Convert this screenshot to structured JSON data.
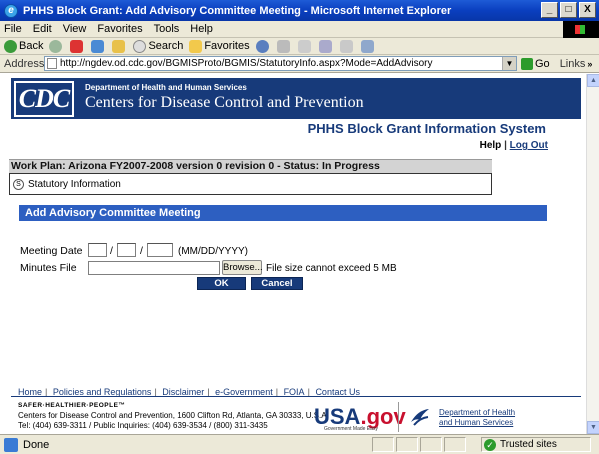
{
  "window": {
    "title": "PHHS Block Grant: Add Advisory Committee Meeting - Microsoft Internet Explorer",
    "minimize": "_",
    "maximize": "□",
    "close": "X"
  },
  "menu": [
    "File",
    "Edit",
    "View",
    "Favorites",
    "Tools",
    "Help"
  ],
  "toolbar": {
    "back": "Back",
    "search": "Search",
    "favorites": "Favorites"
  },
  "address": {
    "label": "Address",
    "url": "http://ngdev.od.cdc.gov/BGMISProto/BGMIS/StatutoryInfo.aspx?Mode=AddAdvisory",
    "go": "Go",
    "links": "Links"
  },
  "header": {
    "logo": "CDC",
    "department": "Department of Health and Human Services",
    "org_name": "Centers for Disease Control and Prevention",
    "system_title": "PHHS Block Grant Information System",
    "help": "Help",
    "separator": "|",
    "logout": "Log Out"
  },
  "workplan": {
    "title": "Work Plan: Arizona FY2007-2008 version 0 revision 0 - Status: In Progress",
    "step_icon": "S",
    "step_label": "Statutory Information"
  },
  "form": {
    "section_title": "Add Advisory Committee Meeting",
    "meeting_date_label": "Meeting Date",
    "date_sep": "/",
    "date_hint": "(MM/DD/YYYY)",
    "minutes_file_label": "Minutes File",
    "browse_label": "Browse...",
    "file_hint": "File size cannot exceed 5 MB",
    "ok_label": "OK",
    "cancel_label": "Cancel"
  },
  "footer": {
    "links": [
      "Home",
      "Policies and Regulations",
      "Disclaimer",
      "e-Government",
      "FOIA",
      "Contact Us"
    ],
    "tagline": "SAFER·HEALTHIER·PEOPLE™",
    "address_line1": "Centers for Disease Control and Prevention, 1600 Clifton Rd, Atlanta, GA 30333, U.S.A",
    "address_line2": "Tel: (404) 639-3311 / Public Inquiries: (404) 639-3534 / (800) 311-3435",
    "usagov_main": "USA",
    "usagov_tld": ".gov",
    "usagov_sub": "Government Made Easy",
    "hhs_line1": "Department of Health",
    "hhs_line2": "and Human Services"
  },
  "status": {
    "text": "Done",
    "zone": "Trusted sites"
  }
}
